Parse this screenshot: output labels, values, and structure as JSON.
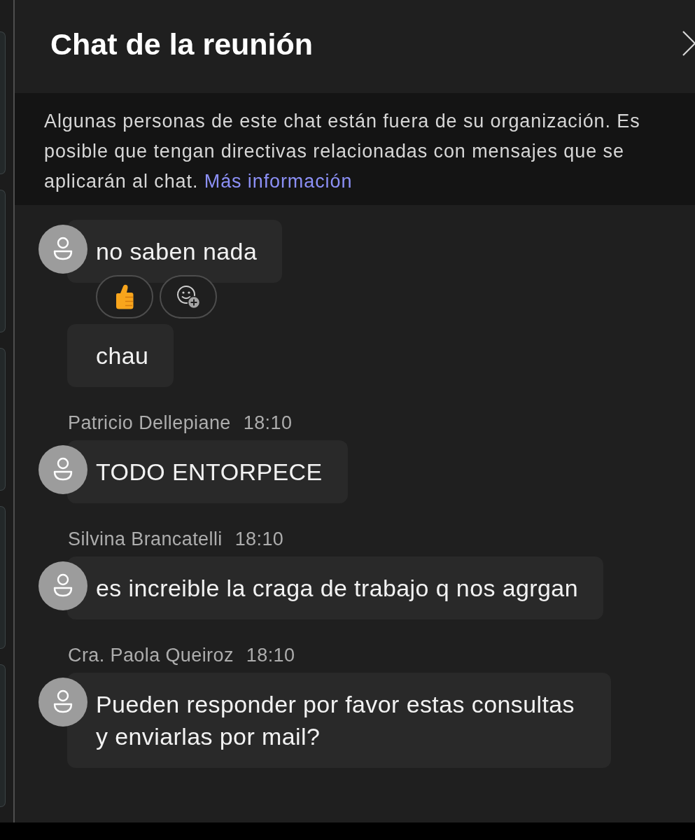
{
  "panel": {
    "title": "Chat de la reunión"
  },
  "notice": {
    "text": "Algunas personas de este chat están fuera de su organización. Es posible que tengan directivas relacionadas con mensajes que se aplicarán al chat.",
    "link": "Más información"
  },
  "groups": [
    {
      "messages": [
        {
          "text": "no saben nada",
          "reactions": [
            {
              "kind": "thumbs_up"
            },
            {
              "kind": "add"
            }
          ]
        },
        {
          "text": "chau"
        }
      ]
    },
    {
      "sender": "Patricio Dellepiane",
      "time": "18:10",
      "messages": [
        {
          "text": "TODO ENTORPECE"
        }
      ]
    },
    {
      "sender": "Silvina Brancatelli",
      "time": "18:10",
      "messages": [
        {
          "text": "es increible la craga de trabajo q nos agrgan"
        }
      ]
    },
    {
      "sender": "Cra. Paola Queiroz",
      "time": "18:10",
      "messages": [
        {
          "text": "Pueden responder por favor estas consultas y enviarlas por mail?"
        }
      ]
    }
  ]
}
